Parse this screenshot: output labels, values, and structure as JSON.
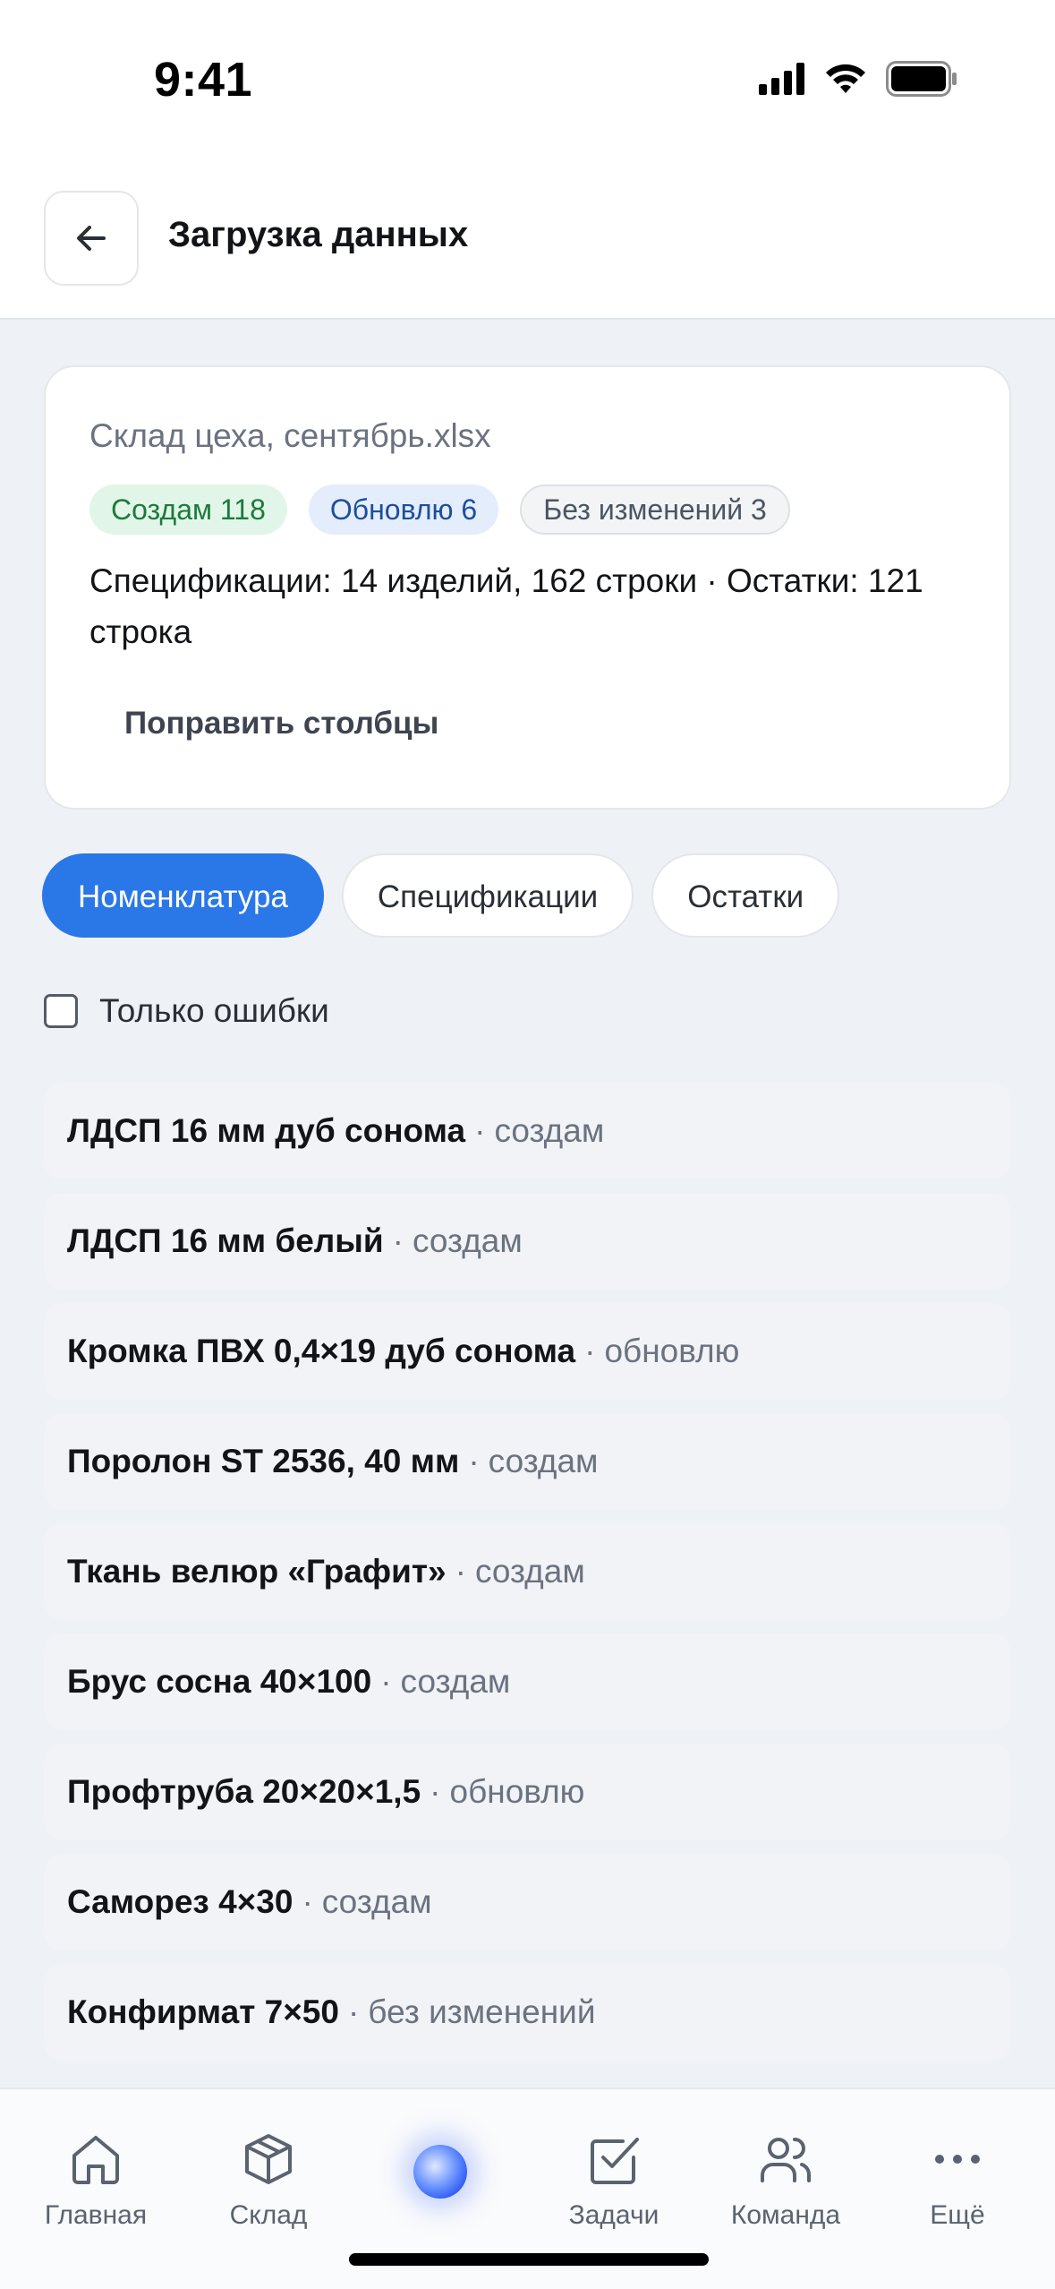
{
  "status_bar": {
    "time": "9:41"
  },
  "header": {
    "title": "Загрузка данных"
  },
  "card": {
    "file_name": "Склад цеха, сентябрь.xlsx",
    "badges": {
      "create": "Создам 118",
      "update": "Обновлю 6",
      "same": "Без изменений 3"
    },
    "summary": "Спецификации: 14 изделий, 162 строки · Остатки: 121 строка",
    "fix_columns": "Поправить столбцы"
  },
  "tabs": [
    {
      "label": "Номенклатура",
      "active": true
    },
    {
      "label": "Спецификации",
      "active": false
    },
    {
      "label": "Остатки",
      "active": false
    }
  ],
  "filter": {
    "label": "Только ошибки",
    "checked": false
  },
  "separator": "·",
  "items": [
    {
      "name": "ЛДСП 16 мм дуб сонома",
      "status": "создам"
    },
    {
      "name": "ЛДСП 16 мм белый",
      "status": "создам"
    },
    {
      "name": "Кромка ПВХ 0,4×19 дуб сонома",
      "status": "обновлю"
    },
    {
      "name": "Поролон ST 2536, 40 мм",
      "status": "создам"
    },
    {
      "name": "Ткань велюр «Графит»",
      "status": "создам"
    },
    {
      "name": "Брус сосна 40×100",
      "status": "создам"
    },
    {
      "name": "Профтруба 20×20×1,5",
      "status": "обновлю"
    },
    {
      "name": "Саморез 4×30",
      "status": "создам"
    },
    {
      "name": "Конфирмат 7×50",
      "status": "без изменений"
    }
  ],
  "nav": [
    {
      "label": "Главная",
      "icon": "home-icon"
    },
    {
      "label": "Склад",
      "icon": "box-icon"
    },
    {
      "label": "Задачи",
      "icon": "checkbox-icon"
    },
    {
      "label": "Команда",
      "icon": "users-icon"
    },
    {
      "label": "Ещё",
      "icon": "more-icon"
    }
  ],
  "colors": {
    "accent": "#2a77e8",
    "create": "#1d7a3b",
    "update": "#1d4f9c"
  }
}
